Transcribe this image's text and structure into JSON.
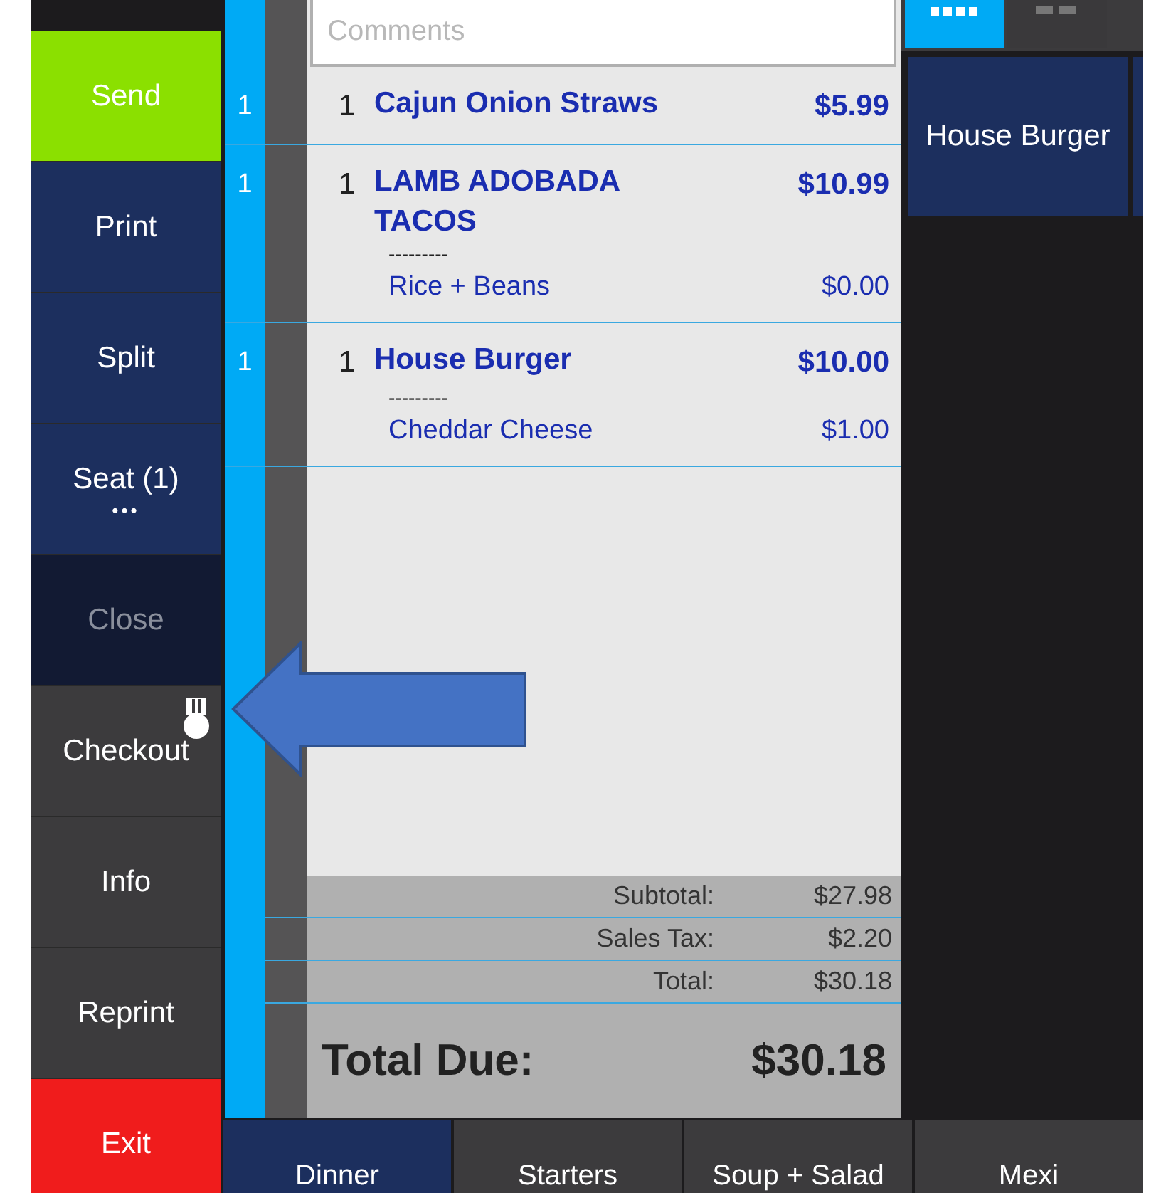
{
  "actions": [
    {
      "label": "Send",
      "kind": "send",
      "disabled": false
    },
    {
      "label": "Print",
      "kind": "primary",
      "disabled": false
    },
    {
      "label": "Split",
      "kind": "primary",
      "disabled": false
    },
    {
      "label": "Seat (1)",
      "kind": "primary",
      "disabled": false,
      "more": "•••"
    },
    {
      "label": "Close",
      "kind": "primary",
      "disabled": true
    },
    {
      "label": "Checkout",
      "kind": "dark",
      "disabled": false,
      "badge": true
    },
    {
      "label": "Info",
      "kind": "dark",
      "disabled": false
    },
    {
      "label": "Reprint",
      "kind": "dark",
      "disabled": false
    },
    {
      "label": "Exit",
      "kind": "danger",
      "disabled": false
    }
  ],
  "ticket": {
    "comments_placeholder": "Comments",
    "items": [
      {
        "seat": "1",
        "qty": "1",
        "name": "Cajun Onion Straws",
        "price": "$5.99"
      },
      {
        "seat": "1",
        "qty": "1",
        "name": "LAMB ADOBADA TACOS",
        "price": "$10.99",
        "modifiers": [
          {
            "separator": "---------",
            "name": "Rice + Beans",
            "price": "$0.00"
          }
        ]
      },
      {
        "seat": "1",
        "qty": "1",
        "name": "House Burger",
        "price": "$10.00",
        "modifiers": [
          {
            "separator": "---------",
            "name": "Cheddar Cheese",
            "price": "$1.00"
          }
        ]
      }
    ],
    "totals": [
      {
        "label": "Subtotal:",
        "value": "$27.98"
      },
      {
        "label": "Sales Tax:",
        "value": "$2.20"
      },
      {
        "label": "Total:",
        "value": "$30.18"
      }
    ],
    "total_due": {
      "label": "Total Due:",
      "value": "$30.18"
    }
  },
  "view_tabs": [
    {
      "selected": true
    },
    {
      "selected": false
    }
  ],
  "menu_items": [
    {
      "label": "House Burger"
    }
  ],
  "categories": [
    {
      "label": "Dinner",
      "selected": true
    },
    {
      "label": "Starters",
      "selected": false
    },
    {
      "label": "Soup + Salad",
      "selected": false
    },
    {
      "label": "Mexi",
      "selected": false
    }
  ]
}
